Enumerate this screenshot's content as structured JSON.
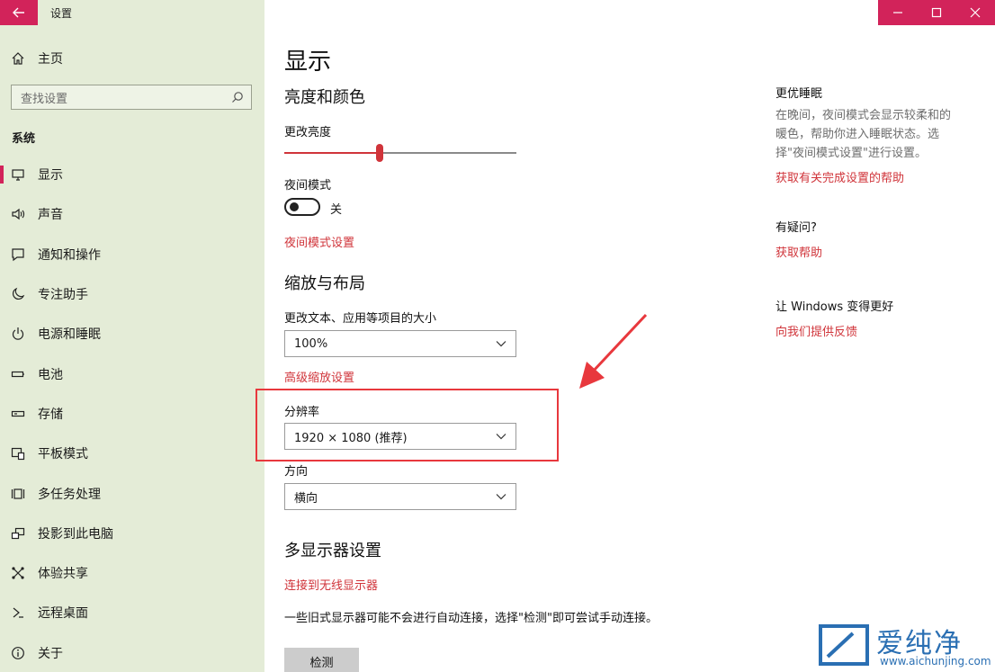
{
  "window": {
    "title": "设置"
  },
  "sidebar": {
    "home_label": "主页",
    "search_placeholder": "查找设置",
    "section": "系统",
    "items": [
      {
        "label": "显示",
        "icon": "monitor-icon",
        "active": true
      },
      {
        "label": "声音",
        "icon": "speaker-icon"
      },
      {
        "label": "通知和操作",
        "icon": "notification-icon"
      },
      {
        "label": "专注助手",
        "icon": "moon-icon"
      },
      {
        "label": "电源和睡眠",
        "icon": "power-icon"
      },
      {
        "label": "电池",
        "icon": "battery-icon"
      },
      {
        "label": "存储",
        "icon": "storage-icon"
      },
      {
        "label": "平板模式",
        "icon": "tablet-icon"
      },
      {
        "label": "多任务处理",
        "icon": "multitask-icon"
      },
      {
        "label": "投影到此电脑",
        "icon": "project-icon"
      },
      {
        "label": "体验共享",
        "icon": "share-icon"
      },
      {
        "label": "远程桌面",
        "icon": "remote-icon"
      },
      {
        "label": "关于",
        "icon": "info-icon"
      }
    ]
  },
  "main": {
    "title": "显示",
    "brightness_color": {
      "heading": "亮度和颜色",
      "brightness_label": "更改亮度",
      "brightness_value": 0.41,
      "night_mode_label": "夜间模式",
      "night_mode_state": "关",
      "night_mode_link": "夜间模式设置"
    },
    "scale_layout": {
      "heading": "缩放与布局",
      "scale_label": "更改文本、应用等项目的大小",
      "scale_value": "100%",
      "advanced_link": "高级缩放设置",
      "resolution_label": "分辨率",
      "resolution_value": "1920 × 1080 (推荐)",
      "orientation_label": "方向",
      "orientation_value": "横向"
    },
    "multi_display": {
      "heading": "多显示器设置",
      "wireless_link": "连接到无线显示器",
      "description": "一些旧式显示器可能不会进行自动连接，选择\"检测\"即可尝试手动连接。",
      "detect_button": "检测"
    }
  },
  "right_panel": {
    "sleep": {
      "heading": "更优睡眠",
      "text": "在晚间，夜间模式会显示较柔和的暖色，帮助你进入睡眠状态。选择\"夜间模式设置\"进行设置。",
      "link": "获取有关完成设置的帮助"
    },
    "question": {
      "heading": "有疑问?",
      "link": "获取帮助"
    },
    "feedback": {
      "heading": "让 Windows 变得更好",
      "link": "向我们提供反馈"
    }
  },
  "watermark": {
    "cn": "爱纯净",
    "en": "www.aichunjing.com"
  },
  "colors": {
    "accent": "#d2235a",
    "link": "#d0343a",
    "sidebar_bg": "#e4ecd7",
    "highlight": "#e8383d"
  }
}
